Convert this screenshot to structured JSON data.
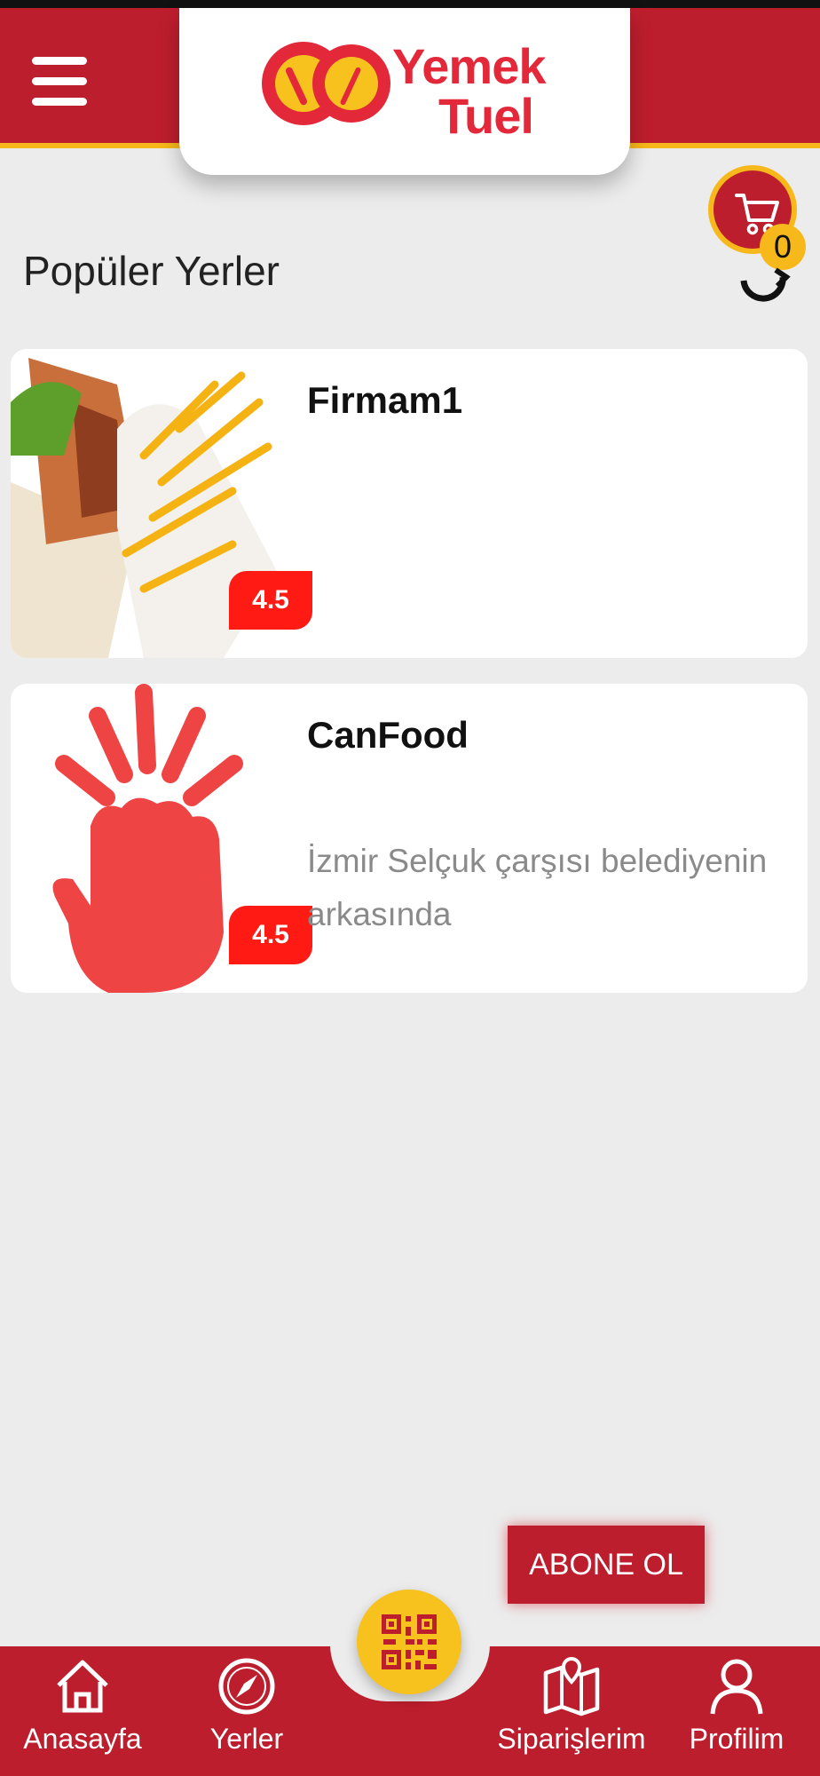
{
  "header": {
    "menu_icon": "hamburger-menu-icon",
    "logo_line1": "Yemek",
    "logo_line2": "Tuel",
    "cart_count": "0"
  },
  "section": {
    "title": "Popüler Yerler"
  },
  "places": [
    {
      "name": "Firmam1",
      "rating": "4.5",
      "address": "",
      "image": "wrap-and-fries-photo"
    },
    {
      "name": "CanFood",
      "rating": "4.5",
      "address": "İzmir Selçuk çarşısı belediyenin arkasında",
      "image": "hand-wave-icon"
    }
  ],
  "subscribe_label": "ABONE OL",
  "bottom_nav": {
    "home": "Anasayfa",
    "places": "Yerler",
    "orders": "Siparişlerim",
    "profile": "Profilim"
  },
  "colors": {
    "brand_red": "#bd1e2d",
    "accent_yellow": "#f6b81a",
    "rating_red": "#ff1a14"
  }
}
